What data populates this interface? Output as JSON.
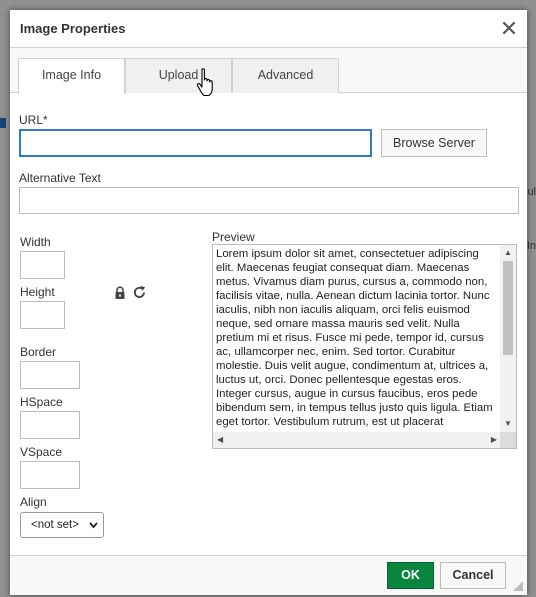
{
  "background": {
    "right_text_1": "ul",
    "right_text_2": "In"
  },
  "dialog": {
    "title": "Image Properties",
    "tabs": [
      {
        "label": "Image Info",
        "active": true
      },
      {
        "label": "Upload",
        "active": false
      },
      {
        "label": "Advanced",
        "active": false
      }
    ],
    "url": {
      "label": "URL*",
      "value": ""
    },
    "browse_server_label": "Browse Server",
    "alt_text": {
      "label": "Alternative Text",
      "value": ""
    },
    "width": {
      "label": "Width",
      "value": ""
    },
    "height": {
      "label": "Height",
      "value": ""
    },
    "lock_icon": "lock-icon",
    "reset_icon": "reset-size-icon",
    "border": {
      "label": "Border",
      "value": ""
    },
    "hspace": {
      "label": "HSpace",
      "value": ""
    },
    "vspace": {
      "label": "VSpace",
      "value": ""
    },
    "align": {
      "label": "Align",
      "selected": "<not set>"
    },
    "preview": {
      "label": "Preview",
      "text": "Lorem ipsum dolor sit amet, consectetuer adipiscing elit. Maecenas feugiat consequat diam. Maecenas metus. Vivamus diam purus, cursus a, commodo non, facilisis vitae, nulla. Aenean dictum lacinia tortor. Nunc iaculis, nibh non iaculis aliquam, orci felis euismod neque, sed ornare massa mauris sed velit. Nulla pretium mi et risus. Fusce mi pede, tempor id, cursus ac, ullamcorper nec, enim. Sed tortor. Curabitur molestie. Duis velit augue, condimentum at, ultrices a, luctus ut, orci. Donec pellentesque egestas eros. Integer cursus, augue in cursus faucibus, eros pede bibendum sem, in tempus tellus justo quis ligula. Etiam eget tortor. Vestibulum rutrum, est ut placerat elementum, lectus nisl aliquam velit, tempor aliquam eros nunc nonummy metus."
    },
    "ok_label": "OK",
    "cancel_label": "Cancel",
    "colors": {
      "ok": "#09863e",
      "focus": "#2e7bcf"
    }
  }
}
